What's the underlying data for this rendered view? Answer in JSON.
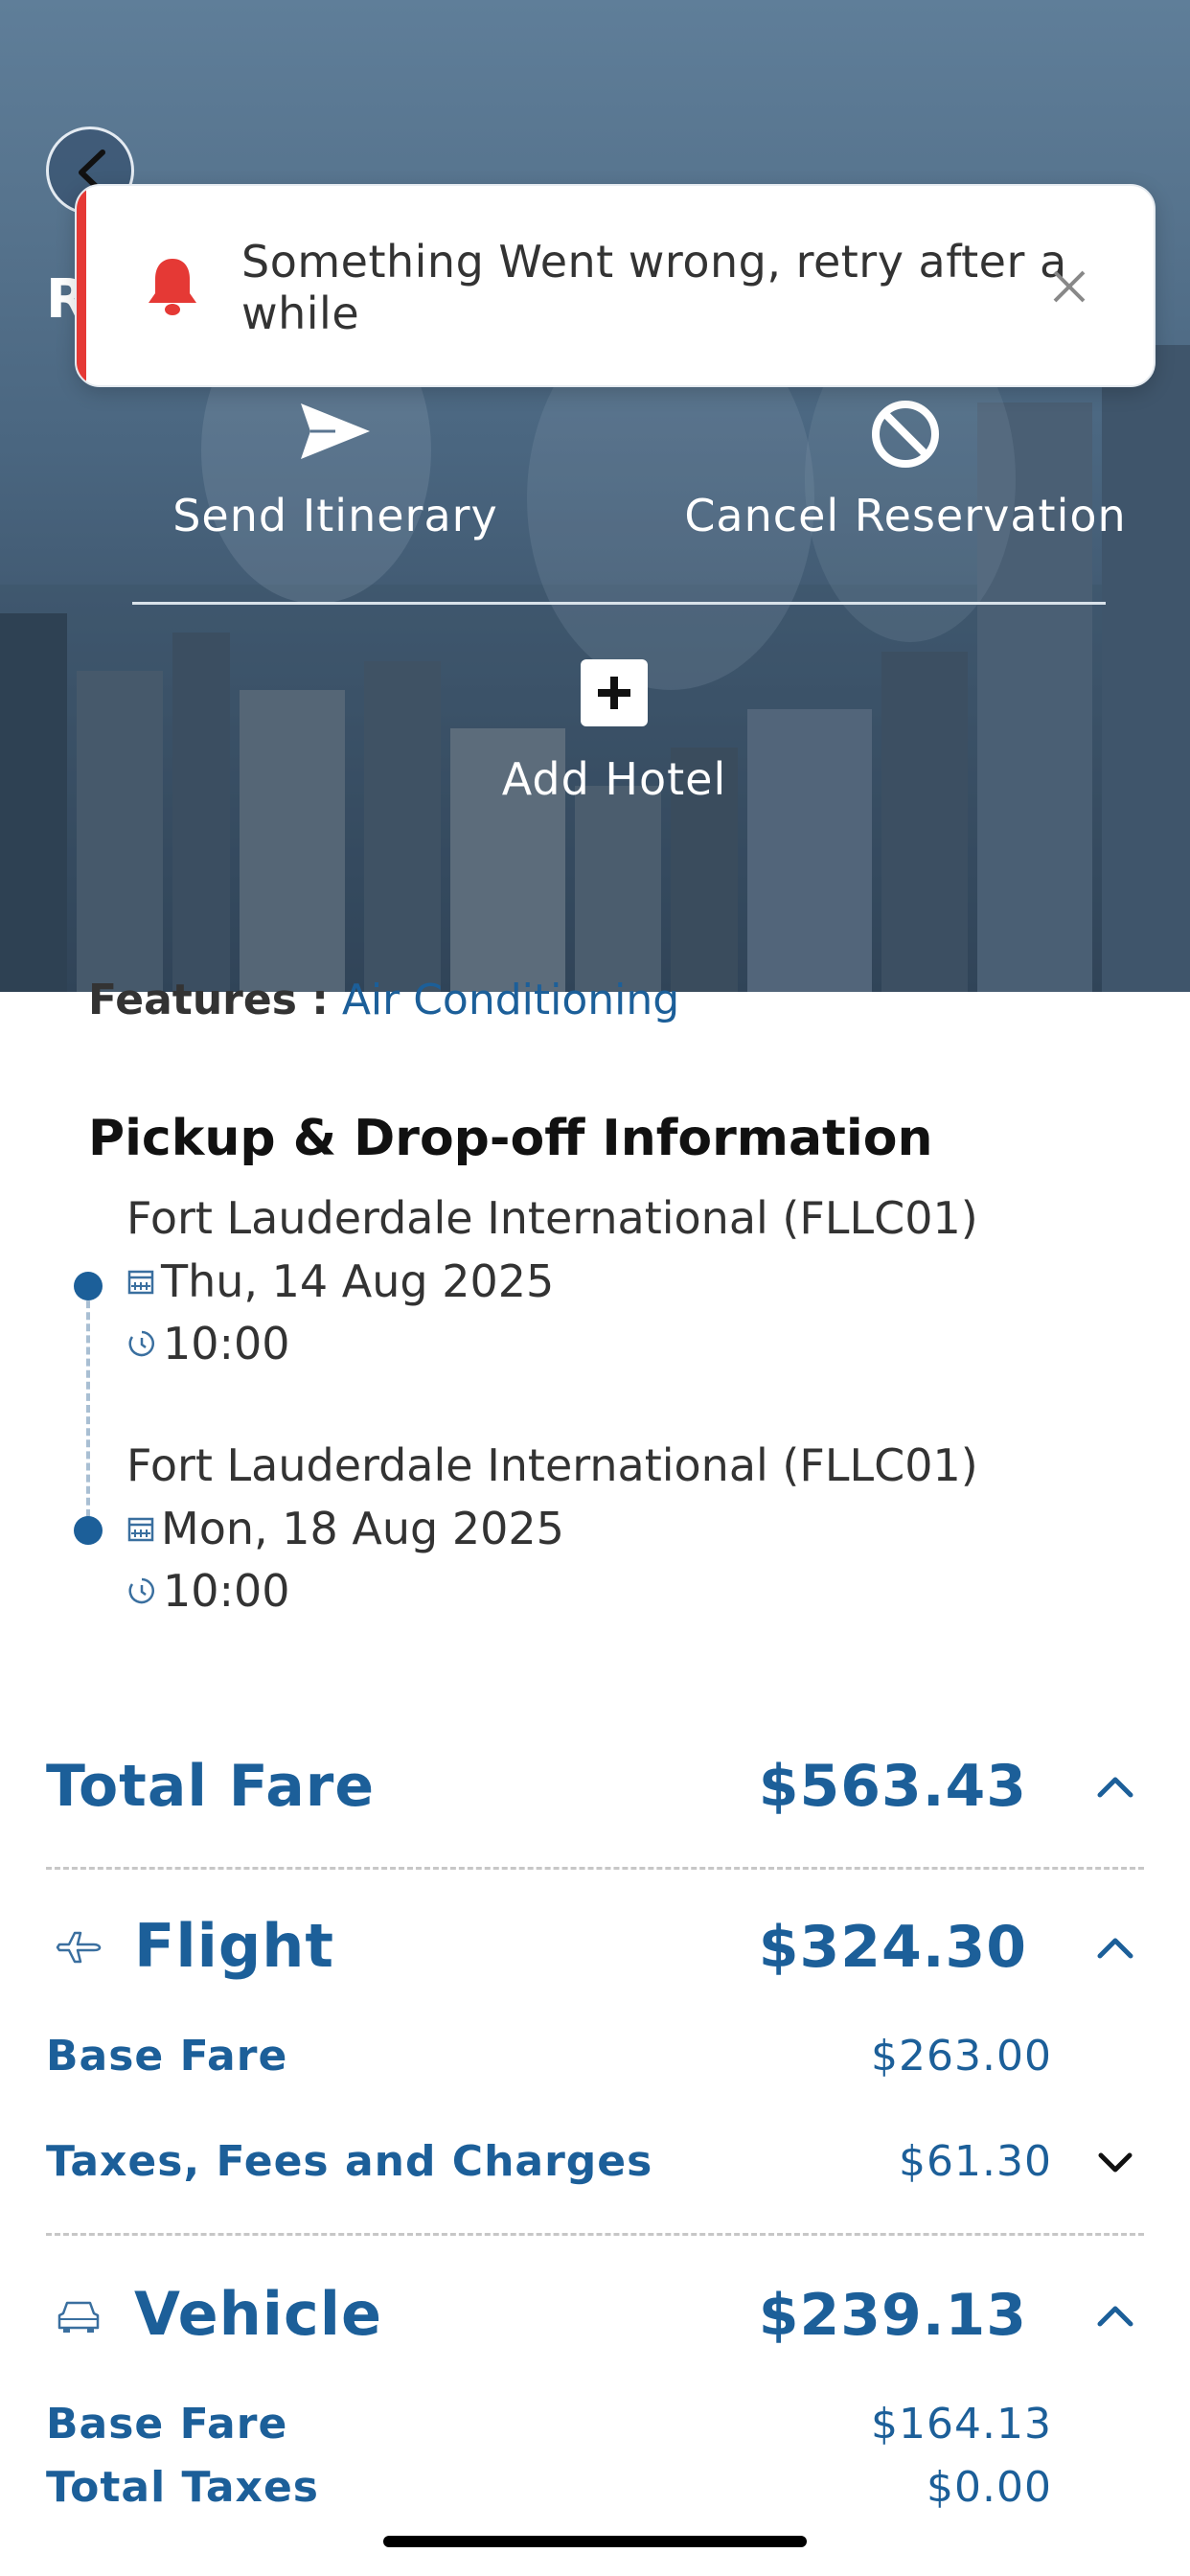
{
  "hero": {
    "title_stub": "R",
    "actions": {
      "send_itinerary": "Send Itinerary",
      "cancel_reservation": "Cancel Reservation",
      "add_hotel": "Add Hotel"
    }
  },
  "toast": {
    "message": "Something Went wrong, retry after a while",
    "accent_color": "#e53935"
  },
  "vehicle_details": {
    "features_label": "Features :",
    "features_value": "Air Conditioning"
  },
  "pickup_dropoff": {
    "title": "Pickup & Drop-off Information",
    "pickup": {
      "location": "Fort Lauderdale International (FLLC01)",
      "date": "Thu, 14 Aug 2025",
      "time": "10:00"
    },
    "dropoff": {
      "location": "Fort Lauderdale International (FLLC01)",
      "date": "Mon, 18 Aug 2025",
      "time": "10:00"
    }
  },
  "fare": {
    "total_label": "Total Fare",
    "total_amount": "$563.43",
    "flight": {
      "label": "Flight",
      "amount": "$324.30",
      "base_fare_label": "Base Fare",
      "base_fare_amount": "$263.00",
      "taxes_label": "Taxes, Fees and Charges",
      "taxes_amount": "$61.30"
    },
    "vehicle": {
      "label": "Vehicle",
      "amount": "$239.13",
      "base_fare_label": "Base Fare",
      "base_fare_amount": "$164.13",
      "total_taxes_label": "Total Taxes",
      "total_taxes_amount": "$0.00"
    }
  },
  "colors": {
    "brand_blue": "#1c5f99",
    "error_red": "#e53935"
  }
}
